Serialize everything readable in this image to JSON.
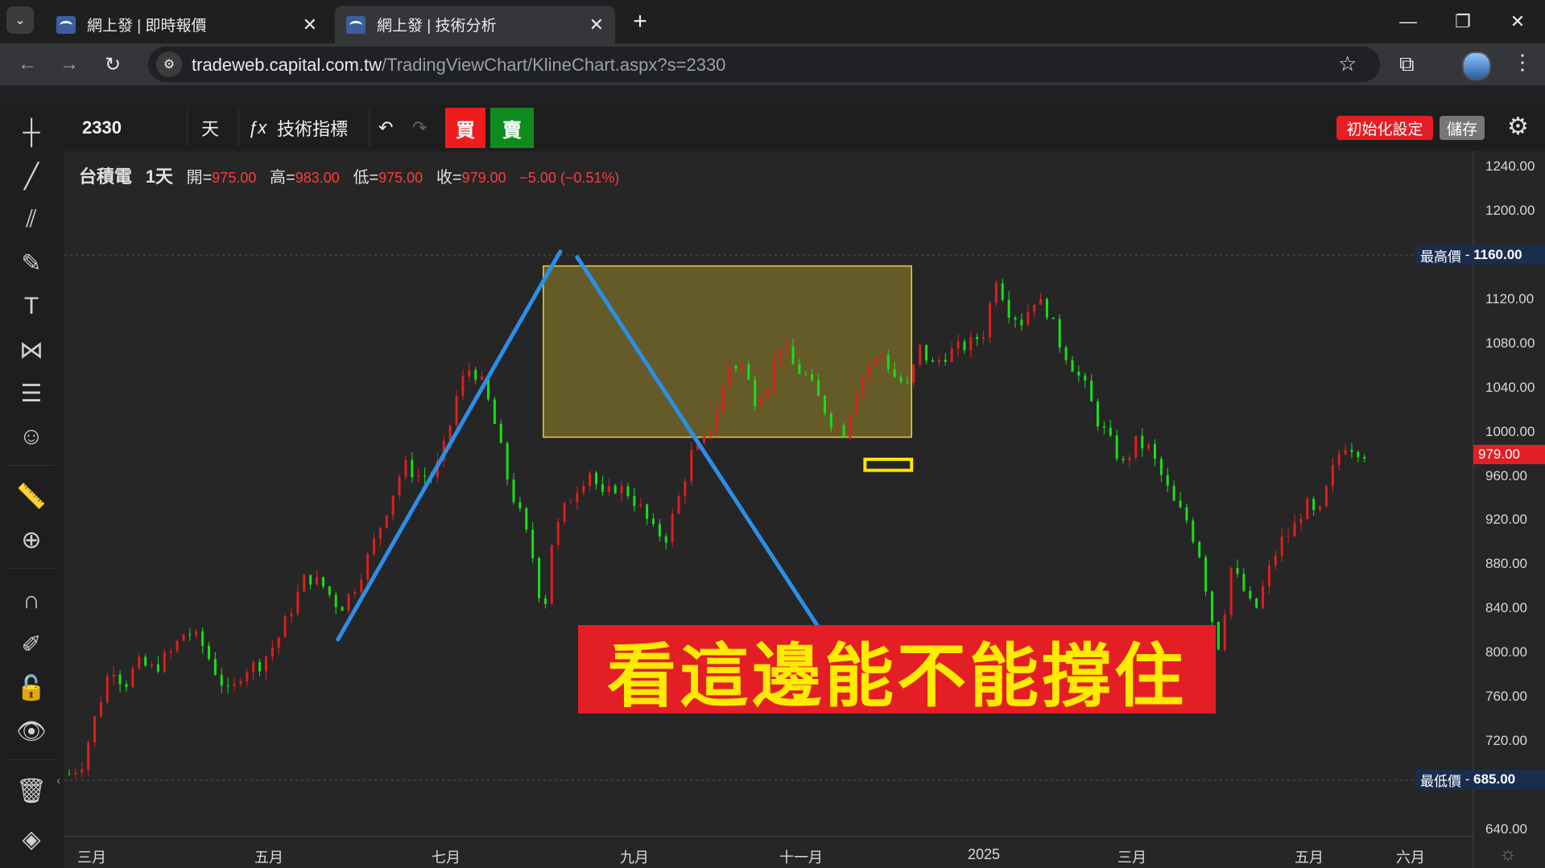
{
  "browser": {
    "tabs": [
      {
        "title": "網上發 | 即時報價",
        "active": false
      },
      {
        "title": "網上發 | 技術分析",
        "active": true
      }
    ],
    "url_domain": "tradeweb.capital.com.tw",
    "url_path": "/TradingViewChart/KlineChart.aspx?s=2330"
  },
  "toolbar": {
    "symbol": "2330",
    "interval": "天",
    "indicators_label": "技術指標",
    "buy_label": "買",
    "sell_label": "賣",
    "reset_label": "初始化設定",
    "save_label": "儲存"
  },
  "legend": {
    "name": "台積電",
    "interval": "1天",
    "open_label": "開=",
    "open": "975.00",
    "high_label": "高=",
    "high": "983.00",
    "low_label": "低=",
    "low": "975.00",
    "close_label": "收=",
    "close": "979.00",
    "change": "−5.00 (−0.51%)"
  },
  "price_markers": {
    "high_label": "最高價",
    "high_value": "1160.00",
    "low_label": "最低價",
    "low_value": "685.00",
    "last_value": "979.00"
  },
  "annotation": {
    "caption": "看這邊能不能撐住"
  },
  "colors": {
    "up": "#e01e1e",
    "down": "#18e018",
    "trendline": "#2b8fe8",
    "zone_fill": "#7a6e2a",
    "zone_border": "#e8d23a",
    "caption_bg": "#e31e24",
    "caption_text": "#ffeb00"
  },
  "chart_data": {
    "type": "candlestick",
    "y_axis_labels": [
      "1240.00",
      "1200.00",
      "1160.00",
      "1120.00",
      "1080.00",
      "1040.00",
      "1000.00",
      "960.00",
      "920.00",
      "880.00",
      "840.00",
      "800.00",
      "760.00",
      "720.00",
      "640.00"
    ],
    "x_axis_labels": [
      "三月",
      "五月",
      "七月",
      "九月",
      "十一月",
      "2025",
      "三月",
      "五月",
      "六月"
    ],
    "ylim": [
      630,
      1250
    ],
    "close_path": [
      [
        0,
        690
      ],
      [
        6,
        700
      ],
      [
        12,
        740
      ],
      [
        20,
        790
      ],
      [
        26,
        770
      ],
      [
        32,
        790
      ],
      [
        40,
        785
      ],
      [
        48,
        800
      ],
      [
        55,
        820
      ],
      [
        62,
        810
      ],
      [
        70,
        780
      ],
      [
        76,
        760
      ],
      [
        82,
        785
      ],
      [
        90,
        790
      ],
      [
        98,
        810
      ],
      [
        105,
        840
      ],
      [
        112,
        870
      ],
      [
        120,
        860
      ],
      [
        128,
        840
      ],
      [
        135,
        860
      ],
      [
        142,
        890
      ],
      [
        150,
        930
      ],
      [
        158,
        970
      ],
      [
        165,
        960
      ],
      [
        172,
        960
      ],
      [
        178,
        990
      ],
      [
        184,
        1040
      ],
      [
        190,
        1060
      ],
      [
        196,
        1040
      ],
      [
        202,
        1000
      ],
      [
        208,
        950
      ],
      [
        214,
        920
      ],
      [
        220,
        880
      ],
      [
        224,
        830
      ],
      [
        228,
        900
      ],
      [
        234,
        930
      ],
      [
        240,
        950
      ],
      [
        246,
        965
      ],
      [
        252,
        940
      ],
      [
        258,
        950
      ],
      [
        264,
        945
      ],
      [
        270,
        930
      ],
      [
        276,
        910
      ],
      [
        282,
        905
      ],
      [
        288,
        940
      ],
      [
        294,
        980
      ],
      [
        300,
        990
      ],
      [
        306,
        1020
      ],
      [
        312,
        1060
      ],
      [
        318,
        1060
      ],
      [
        324,
        1030
      ],
      [
        330,
        1045
      ],
      [
        336,
        1080
      ],
      [
        342,
        1060
      ],
      [
        348,
        1050
      ],
      [
        354,
        1030
      ],
      [
        360,
        1010
      ],
      [
        366,
        1000
      ],
      [
        372,
        1040
      ],
      [
        378,
        1060
      ],
      [
        384,
        1070
      ],
      [
        390,
        1050
      ],
      [
        396,
        1040
      ],
      [
        402,
        1075
      ],
      [
        408,
        1060
      ],
      [
        414,
        1070
      ],
      [
        420,
        1075
      ],
      [
        426,
        1080
      ],
      [
        432,
        1090
      ],
      [
        438,
        1140
      ],
      [
        444,
        1110
      ],
      [
        450,
        1100
      ],
      [
        456,
        1120
      ],
      [
        462,
        1110
      ],
      [
        468,
        1080
      ],
      [
        474,
        1060
      ],
      [
        480,
        1040
      ],
      [
        486,
        1010
      ],
      [
        492,
        990
      ],
      [
        498,
        970
      ],
      [
        504,
        990
      ],
      [
        510,
        985
      ],
      [
        516,
        960
      ],
      [
        522,
        935
      ],
      [
        528,
        920
      ],
      [
        534,
        890
      ],
      [
        540,
        830
      ],
      [
        544,
        800
      ],
      [
        548,
        880
      ],
      [
        554,
        860
      ],
      [
        560,
        835
      ],
      [
        566,
        870
      ],
      [
        572,
        900
      ],
      [
        578,
        910
      ],
      [
        584,
        935
      ],
      [
        590,
        920
      ],
      [
        596,
        960
      ],
      [
        602,
        990
      ],
      [
        608,
        985
      ],
      [
        614,
        979
      ]
    ],
    "resistance_zone": {
      "top": 1150,
      "bottom": 995,
      "from_index": 224,
      "to_index": 398
    },
    "trendlines": [
      {
        "from": [
          127,
          812
        ],
        "to": [
          232,
          1163
        ]
      },
      {
        "from": [
          240,
          1158
        ],
        "to": [
          355,
          820
        ]
      }
    ],
    "marker_box": {
      "from_index": 376,
      "to_index": 398,
      "top": 975,
      "bottom": 965
    }
  }
}
